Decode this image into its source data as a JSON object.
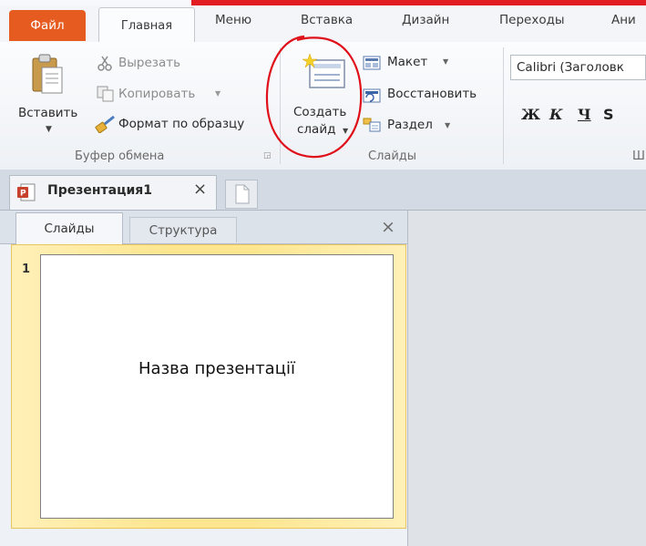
{
  "tabs": {
    "file": "Файл",
    "home": "Главная",
    "menu": "Меню",
    "insert": "Вставка",
    "design": "Дизайн",
    "transitions": "Переходы",
    "animations": "Ани"
  },
  "clipboard": {
    "paste": "Вставить",
    "cut": "Вырезать",
    "copy": "Копировать",
    "format_painter": "Формат по образцу",
    "group_label": "Буфер обмена"
  },
  "slides_group": {
    "new_slide_line1": "Создать",
    "new_slide_line2": "слайд",
    "layout": "Макет",
    "reset": "Восстановить",
    "section": "Раздел",
    "group_label": "Слайды"
  },
  "font_group": {
    "font_name": "Calibri (Заголовк",
    "bold": "Ж",
    "italic": "К",
    "underline": "Ч",
    "strike": "S",
    "group_label_partial": "Ш"
  },
  "document": {
    "tab_title": "Презентация1",
    "close_symbol": "×"
  },
  "pane": {
    "tab_slides": "Слайды",
    "tab_outline": "Структура",
    "close_symbol": "×",
    "slide_number": "1",
    "slide_title": "Назва презентації"
  },
  "colors": {
    "file_tab": "#e55b20",
    "highlight_circle": "#e0101a",
    "selected_slide_bg": "#fde68f"
  }
}
